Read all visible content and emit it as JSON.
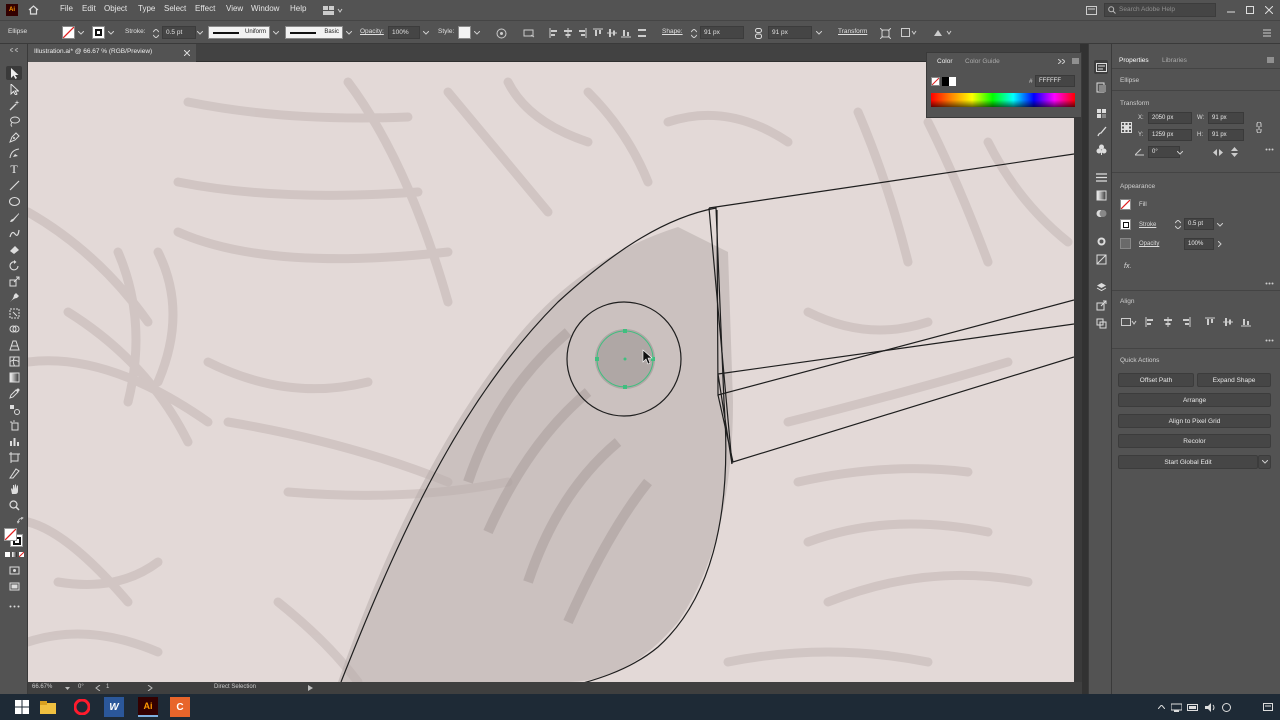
{
  "menubar": {
    "items": [
      "File",
      "Edit",
      "Object",
      "Type",
      "Select",
      "Effect",
      "View",
      "Window",
      "Help"
    ],
    "search_placeholder": "Search Adobe Help"
  },
  "control_bar": {
    "object_type": "Ellipse",
    "stroke_label": "Stroke:",
    "stroke_value": "0.5 pt",
    "profile": "Uniform",
    "brush": "Basic",
    "opacity_label": "Opacity:",
    "opacity_value": "100%",
    "style_label": "Style:",
    "shape_label": "Shape:",
    "shape_w": "91 px",
    "shape_h": "91 px",
    "transform_label": "Transform"
  },
  "document": {
    "tab_title": "Illustration.ai* @ 66.67 % (RGB/Preview)",
    "zoom": "66.67%",
    "rotation": "0°",
    "artboard": "1",
    "status": "Direct Selection"
  },
  "color_panel": {
    "tabs": [
      "Color",
      "Color Guide"
    ],
    "hex": "FFFFFF"
  },
  "properties": {
    "tabs": [
      "Properties",
      "Libraries"
    ],
    "object": "Ellipse",
    "transform_title": "Transform",
    "x_label": "X:",
    "x_value": "2050 px",
    "y_label": "Y:",
    "y_value": "1259 px",
    "w_label": "W:",
    "w_value": "91 px",
    "h_label": "H:",
    "h_value": "91 px",
    "angle_value": "0°",
    "appearance_title": "Appearance",
    "fill_label": "Fill",
    "stroke_label": "Stroke",
    "stroke_value": "0.5 pt",
    "opacity_label": "Opacity",
    "opacity_value": "100%",
    "fx_label": "fx.",
    "align_title": "Align",
    "quick_actions_title": "Quick Actions",
    "qa": {
      "offset_path": "Offset Path",
      "expand_shape": "Expand Shape",
      "arrange": "Arrange",
      "align_pixel": "Align to Pixel Grid",
      "recolor": "Recolor",
      "global_edit": "Start Global Edit"
    }
  },
  "taskbar": {
    "apps": [
      "File Explorer",
      "Opera",
      "Word",
      "Illustrator",
      "Camtasia"
    ],
    "word_label": "W",
    "ai_label": "Ai",
    "camtasia_label": "C"
  },
  "colors": {
    "ui_bg": "#535353",
    "canvas": "#e3d9d7",
    "selection": "#3fbf7f",
    "ai_brand": "#ff9a00"
  }
}
